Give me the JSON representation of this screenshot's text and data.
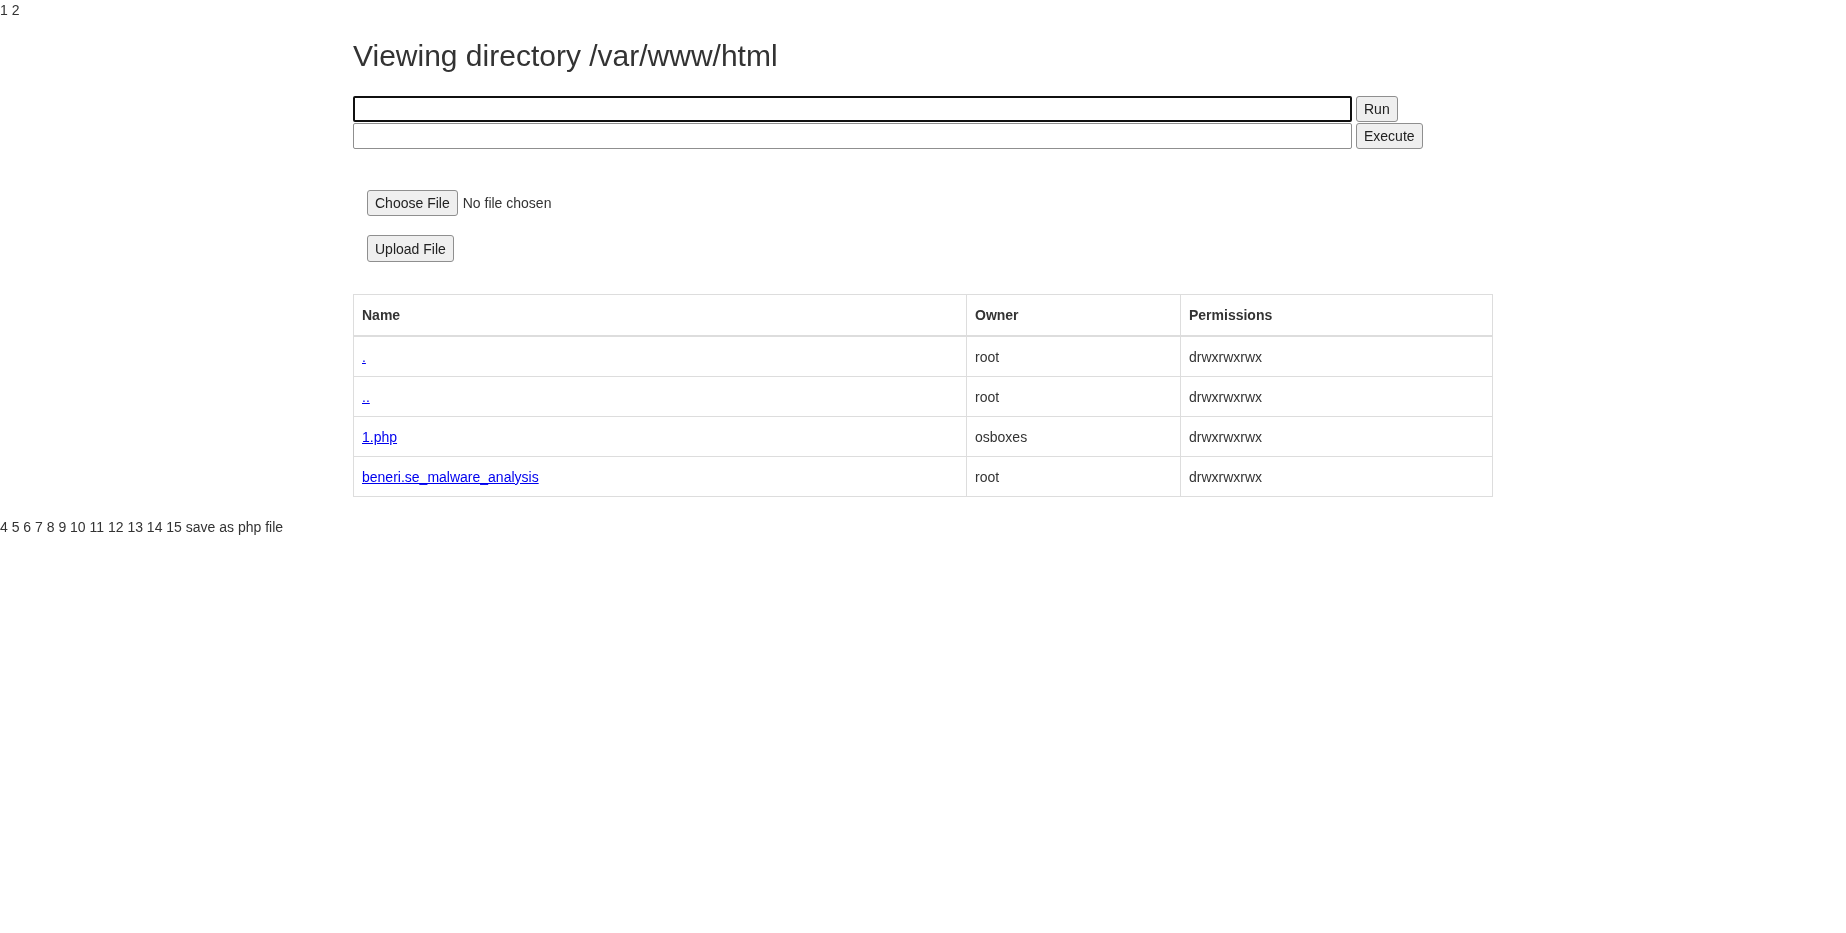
{
  "top_text": "1 2",
  "title": "Viewing directory /var/www/html",
  "command_rows": [
    {
      "button": "Run",
      "focused": true
    },
    {
      "button": "Execute",
      "focused": false
    }
  ],
  "file_picker": {
    "button": "Choose File",
    "status": "No file chosen"
  },
  "upload_button": "Upload File",
  "table": {
    "columns": [
      "Name",
      "Owner",
      "Permissions"
    ],
    "rows": [
      {
        "name": ".",
        "owner": "root",
        "permissions": "drwxrwxrwx"
      },
      {
        "name": "..",
        "owner": "root",
        "permissions": "drwxrwxrwx"
      },
      {
        "name": "1.php",
        "owner": "osboxes",
        "permissions": "drwxrwxrwx"
      },
      {
        "name": "beneri.se_malware_analysis",
        "owner": "root",
        "permissions": "drwxrwxrwx"
      }
    ]
  },
  "footer_text": "4 5 6 7 8 9 10 11 12 13 14 15 save as php file"
}
